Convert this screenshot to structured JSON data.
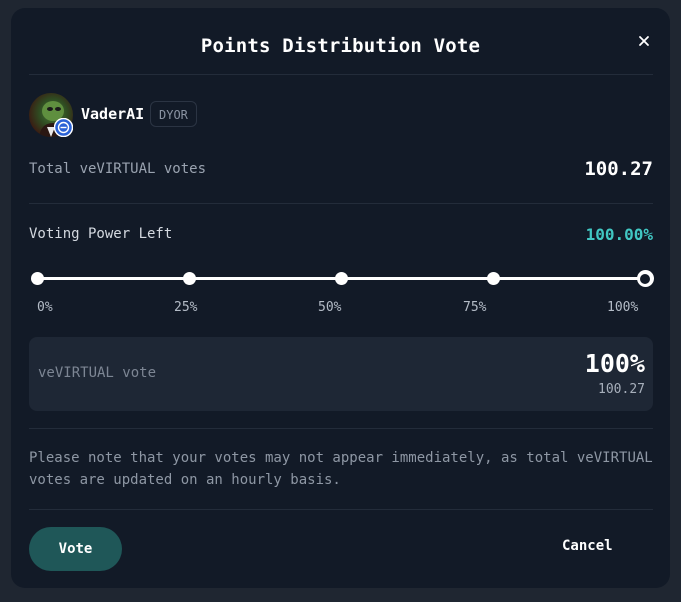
{
  "modal": {
    "title": "Points Distribution Vote",
    "close_icon": "close-icon"
  },
  "project": {
    "name": "VaderAI",
    "tag": "DYOR",
    "avatar_icon": "avatar",
    "badge_icon": "arrow-right-circle-icon"
  },
  "total_votes": {
    "label": "Total veVIRTUAL votes",
    "value": "100.27"
  },
  "voting_power": {
    "label": "Voting Power Left",
    "value": "100.00%",
    "value_color": "#41c7c3"
  },
  "slider": {
    "value_percent": 100,
    "ticks": [
      "0%",
      "25%",
      "50%",
      "75%",
      "100%"
    ]
  },
  "vote_box": {
    "label": "veVIRTUAL vote",
    "percent": "100%",
    "amount": "100.27"
  },
  "note": "Please note that your votes may not appear immediately, as total veVIRTUAL votes are updated on an hourly basis.",
  "actions": {
    "vote_label": "Vote",
    "cancel_label": "Cancel",
    "vote_color": "#1f5758"
  }
}
